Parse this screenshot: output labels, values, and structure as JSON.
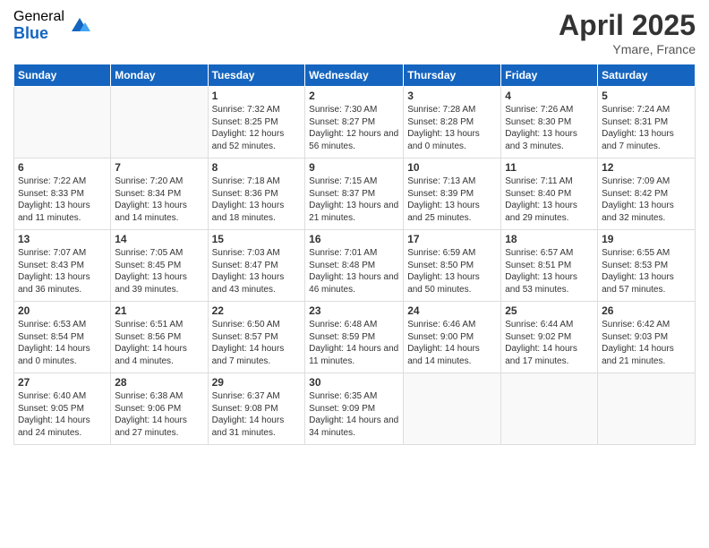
{
  "logo": {
    "general": "General",
    "blue": "Blue"
  },
  "header": {
    "month": "April 2025",
    "location": "Ymare, France"
  },
  "weekdays": [
    "Sunday",
    "Monday",
    "Tuesday",
    "Wednesday",
    "Thursday",
    "Friday",
    "Saturday"
  ],
  "weeks": [
    [
      {
        "day": "",
        "empty": true
      },
      {
        "day": "",
        "empty": true
      },
      {
        "day": "1",
        "sunrise": "Sunrise: 7:32 AM",
        "sunset": "Sunset: 8:25 PM",
        "daylight": "Daylight: 12 hours and 52 minutes."
      },
      {
        "day": "2",
        "sunrise": "Sunrise: 7:30 AM",
        "sunset": "Sunset: 8:27 PM",
        "daylight": "Daylight: 12 hours and 56 minutes."
      },
      {
        "day": "3",
        "sunrise": "Sunrise: 7:28 AM",
        "sunset": "Sunset: 8:28 PM",
        "daylight": "Daylight: 13 hours and 0 minutes."
      },
      {
        "day": "4",
        "sunrise": "Sunrise: 7:26 AM",
        "sunset": "Sunset: 8:30 PM",
        "daylight": "Daylight: 13 hours and 3 minutes."
      },
      {
        "day": "5",
        "sunrise": "Sunrise: 7:24 AM",
        "sunset": "Sunset: 8:31 PM",
        "daylight": "Daylight: 13 hours and 7 minutes."
      }
    ],
    [
      {
        "day": "6",
        "sunrise": "Sunrise: 7:22 AM",
        "sunset": "Sunset: 8:33 PM",
        "daylight": "Daylight: 13 hours and 11 minutes."
      },
      {
        "day": "7",
        "sunrise": "Sunrise: 7:20 AM",
        "sunset": "Sunset: 8:34 PM",
        "daylight": "Daylight: 13 hours and 14 minutes."
      },
      {
        "day": "8",
        "sunrise": "Sunrise: 7:18 AM",
        "sunset": "Sunset: 8:36 PM",
        "daylight": "Daylight: 13 hours and 18 minutes."
      },
      {
        "day": "9",
        "sunrise": "Sunrise: 7:15 AM",
        "sunset": "Sunset: 8:37 PM",
        "daylight": "Daylight: 13 hours and 21 minutes."
      },
      {
        "day": "10",
        "sunrise": "Sunrise: 7:13 AM",
        "sunset": "Sunset: 8:39 PM",
        "daylight": "Daylight: 13 hours and 25 minutes."
      },
      {
        "day": "11",
        "sunrise": "Sunrise: 7:11 AM",
        "sunset": "Sunset: 8:40 PM",
        "daylight": "Daylight: 13 hours and 29 minutes."
      },
      {
        "day": "12",
        "sunrise": "Sunrise: 7:09 AM",
        "sunset": "Sunset: 8:42 PM",
        "daylight": "Daylight: 13 hours and 32 minutes."
      }
    ],
    [
      {
        "day": "13",
        "sunrise": "Sunrise: 7:07 AM",
        "sunset": "Sunset: 8:43 PM",
        "daylight": "Daylight: 13 hours and 36 minutes."
      },
      {
        "day": "14",
        "sunrise": "Sunrise: 7:05 AM",
        "sunset": "Sunset: 8:45 PM",
        "daylight": "Daylight: 13 hours and 39 minutes."
      },
      {
        "day": "15",
        "sunrise": "Sunrise: 7:03 AM",
        "sunset": "Sunset: 8:47 PM",
        "daylight": "Daylight: 13 hours and 43 minutes."
      },
      {
        "day": "16",
        "sunrise": "Sunrise: 7:01 AM",
        "sunset": "Sunset: 8:48 PM",
        "daylight": "Daylight: 13 hours and 46 minutes."
      },
      {
        "day": "17",
        "sunrise": "Sunrise: 6:59 AM",
        "sunset": "Sunset: 8:50 PM",
        "daylight": "Daylight: 13 hours and 50 minutes."
      },
      {
        "day": "18",
        "sunrise": "Sunrise: 6:57 AM",
        "sunset": "Sunset: 8:51 PM",
        "daylight": "Daylight: 13 hours and 53 minutes."
      },
      {
        "day": "19",
        "sunrise": "Sunrise: 6:55 AM",
        "sunset": "Sunset: 8:53 PM",
        "daylight": "Daylight: 13 hours and 57 minutes."
      }
    ],
    [
      {
        "day": "20",
        "sunrise": "Sunrise: 6:53 AM",
        "sunset": "Sunset: 8:54 PM",
        "daylight": "Daylight: 14 hours and 0 minutes."
      },
      {
        "day": "21",
        "sunrise": "Sunrise: 6:51 AM",
        "sunset": "Sunset: 8:56 PM",
        "daylight": "Daylight: 14 hours and 4 minutes."
      },
      {
        "day": "22",
        "sunrise": "Sunrise: 6:50 AM",
        "sunset": "Sunset: 8:57 PM",
        "daylight": "Daylight: 14 hours and 7 minutes."
      },
      {
        "day": "23",
        "sunrise": "Sunrise: 6:48 AM",
        "sunset": "Sunset: 8:59 PM",
        "daylight": "Daylight: 14 hours and 11 minutes."
      },
      {
        "day": "24",
        "sunrise": "Sunrise: 6:46 AM",
        "sunset": "Sunset: 9:00 PM",
        "daylight": "Daylight: 14 hours and 14 minutes."
      },
      {
        "day": "25",
        "sunrise": "Sunrise: 6:44 AM",
        "sunset": "Sunset: 9:02 PM",
        "daylight": "Daylight: 14 hours and 17 minutes."
      },
      {
        "day": "26",
        "sunrise": "Sunrise: 6:42 AM",
        "sunset": "Sunset: 9:03 PM",
        "daylight": "Daylight: 14 hours and 21 minutes."
      }
    ],
    [
      {
        "day": "27",
        "sunrise": "Sunrise: 6:40 AM",
        "sunset": "Sunset: 9:05 PM",
        "daylight": "Daylight: 14 hours and 24 minutes."
      },
      {
        "day": "28",
        "sunrise": "Sunrise: 6:38 AM",
        "sunset": "Sunset: 9:06 PM",
        "daylight": "Daylight: 14 hours and 27 minutes."
      },
      {
        "day": "29",
        "sunrise": "Sunrise: 6:37 AM",
        "sunset": "Sunset: 9:08 PM",
        "daylight": "Daylight: 14 hours and 31 minutes."
      },
      {
        "day": "30",
        "sunrise": "Sunrise: 6:35 AM",
        "sunset": "Sunset: 9:09 PM",
        "daylight": "Daylight: 14 hours and 34 minutes."
      },
      {
        "day": "",
        "empty": true
      },
      {
        "day": "",
        "empty": true
      },
      {
        "day": "",
        "empty": true
      }
    ]
  ]
}
